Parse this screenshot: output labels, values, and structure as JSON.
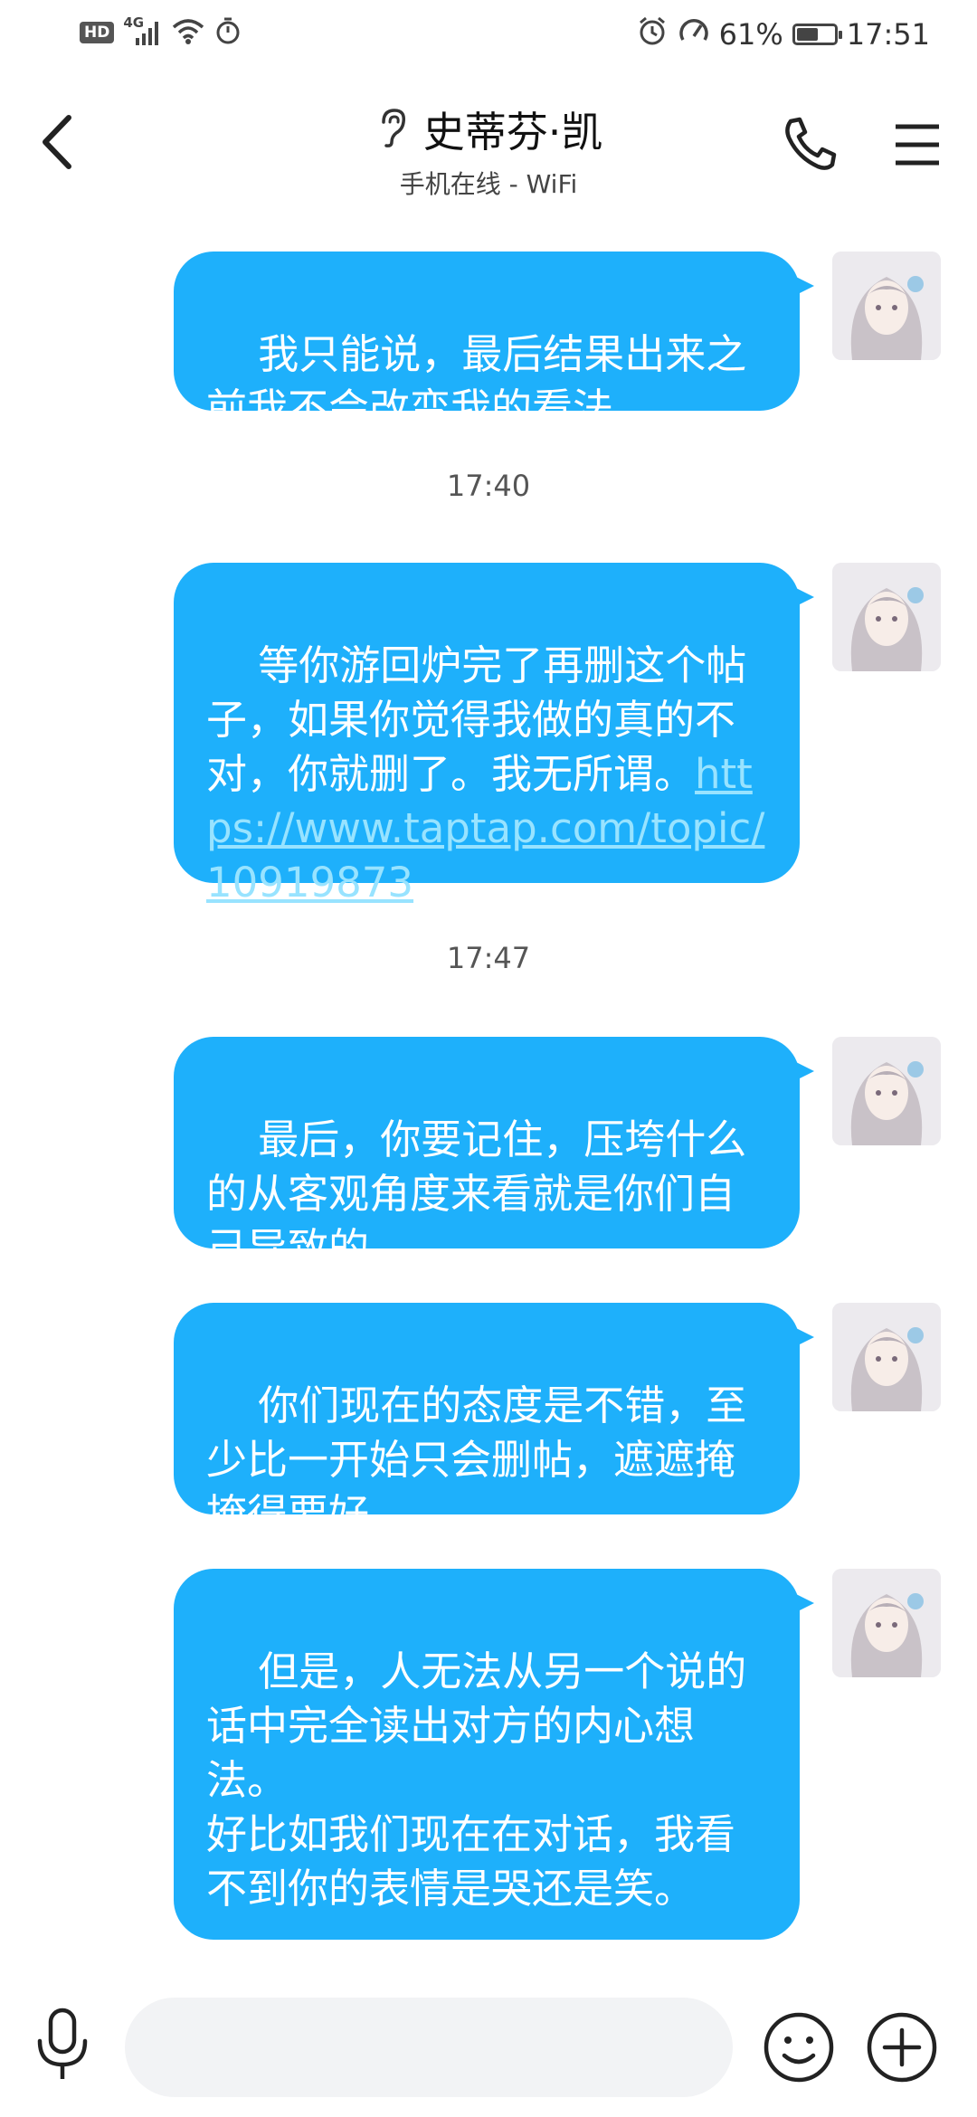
{
  "status_bar": {
    "hd": "HD",
    "network": "4G",
    "battery": "61%",
    "battery_level": 0.61,
    "time": "17:51"
  },
  "header": {
    "title": "史蒂芬·凯",
    "subtitle": "手机在线 - WiFi"
  },
  "messages": [
    {
      "text": "我只能说，最后结果出来之前我不会改变我的看法。"
    },
    {
      "text": "等你游回炉完了再删这个帖子，如果你觉得我做的真的不对，你就删了。我无所谓。",
      "link": "https://www.taptap.com/topic/10919873"
    },
    {
      "text": "最后，你要记住，压垮什么的从客观角度来看就是你们自己导致的。"
    },
    {
      "text": "你们现在的态度是不错，至少比一开始只会删帖，遮遮掩掩得要好。"
    },
    {
      "text": "但是，人无法从另一个说的话中完全读出对方的内心想法。\n好比如我们现在在对话，我看不到你的表情是哭还是笑。"
    }
  ],
  "timestamps": [
    "17:40",
    "17:47"
  ],
  "input": {
    "value": "",
    "placeholder": ""
  },
  "colors": {
    "bubble": "#1EB0FB",
    "link": "#98E3FF",
    "input_bg": "#f2f3f5"
  },
  "icons": {
    "back": "chevron-left-icon",
    "hearing": "ear-icon",
    "call": "phone-icon",
    "menu": "hamburger-menu-icon",
    "mic": "microphone-icon",
    "emoji": "smiley-icon",
    "plus": "plus-circle-icon"
  }
}
